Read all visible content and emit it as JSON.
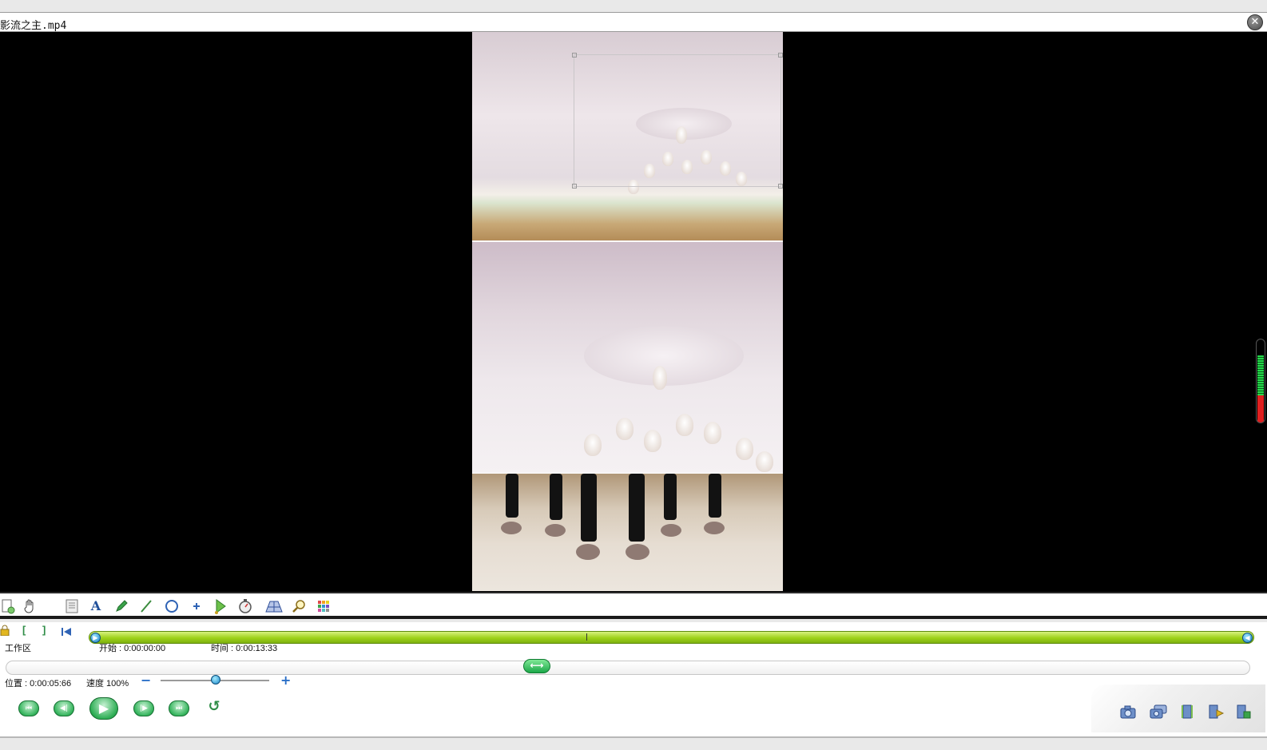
{
  "window": {
    "title": "影流之主.mp4",
    "close_glyph": "✕"
  },
  "toolbar": {
    "icons": [
      "new-doc-icon",
      "hand-pan-icon",
      "notes-icon",
      "text-icon",
      "pencil-icon",
      "line-icon",
      "circle-icon",
      "point-icon",
      "angle-icon",
      "stopwatch-icon",
      "perspective-grid-icon",
      "magnifier-icon",
      "color-grid-icon"
    ],
    "text_tool_glyph": "A"
  },
  "timeline": {
    "workspace_label": "工作区",
    "start_label": "开始 : 0:00:00:00",
    "duration_label": "时间 : 0:00:13:33",
    "position_label": "位置 : 0:00:05:66",
    "speed_label": "速度 100%",
    "speed_percent": 100,
    "playhead_fraction": 0.425,
    "mark_in_glyph": "[",
    "mark_out_glyph": "]",
    "minus_glyph": "−",
    "plus_glyph": "+"
  },
  "playback": {
    "first_glyph": "⏮",
    "prev_glyph": "◀|",
    "play_glyph": "▶",
    "next_glyph": "|▶",
    "last_glyph": "⏭",
    "loop_glyph": "↺"
  },
  "export": {
    "icons": [
      "snapshot-camera-icon",
      "multi-snapshot-icon",
      "film-clip-icon",
      "film-export-icon",
      "film-save-icon"
    ]
  },
  "colors": {
    "workbar": "#9ed21a",
    "accent_blue": "#1a7fc4",
    "play_green": "#2fae55",
    "meter_red": "#e02020"
  }
}
